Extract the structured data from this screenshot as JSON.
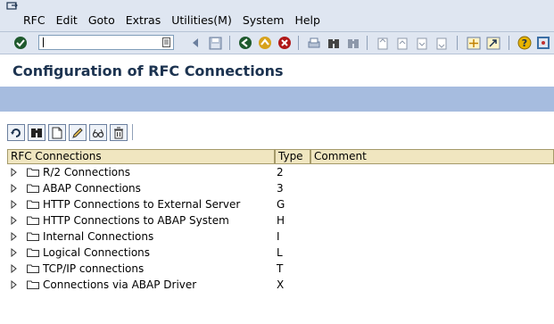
{
  "menu": {
    "items": [
      {
        "label": "RFC"
      },
      {
        "label": "Edit"
      },
      {
        "label": "Goto"
      },
      {
        "label": "Extras"
      },
      {
        "label": "Utilities(M)"
      },
      {
        "label": "System"
      },
      {
        "label": "Help"
      }
    ]
  },
  "toolbar": {
    "command_field_value": ""
  },
  "page": {
    "title": "Configuration of RFC Connections"
  },
  "tree": {
    "columns": [
      "RFC Connections",
      "Type",
      "Comment"
    ],
    "rows": [
      {
        "label": "R/2 Connections",
        "type": "2"
      },
      {
        "label": "ABAP Connections",
        "type": "3"
      },
      {
        "label": "HTTP Connections to External Server",
        "type": "G"
      },
      {
        "label": "HTTP Connections to ABAP System",
        "type": "H"
      },
      {
        "label": "Internal Connections",
        "type": "I"
      },
      {
        "label": "Logical Connections",
        "type": "L"
      },
      {
        "label": "TCP/IP connections",
        "type": "T"
      },
      {
        "label": "Connections via ABAP Driver",
        "type": "X"
      }
    ]
  },
  "colors": {
    "menubar_bg": "#dfe6f1",
    "app_bar": "#a6bcdf",
    "header_bg": "#f0e6c0",
    "title_color": "#1c3350"
  }
}
